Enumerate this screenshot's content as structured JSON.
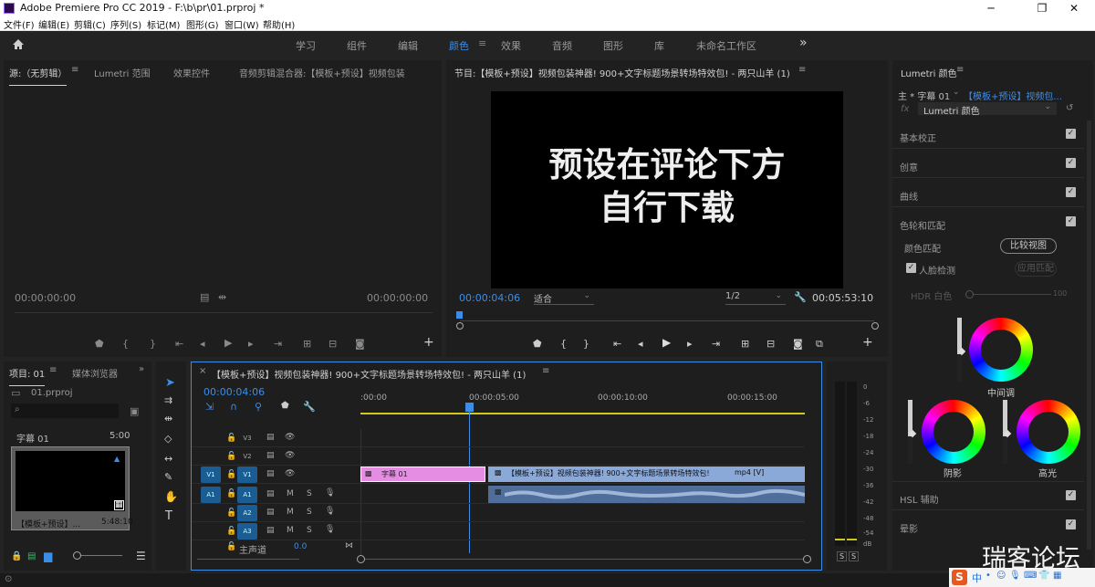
{
  "titlebar": {
    "title": "Adobe Premiere Pro CC 2019 - F:\\b\\pr\\01.prproj *",
    "min": "─",
    "max": "❐",
    "close": "✕"
  },
  "menu": [
    "文件(F)",
    "编辑(E)",
    "剪辑(C)",
    "序列(S)",
    "标记(M)",
    "图形(G)",
    "窗口(W)",
    "帮助(H)"
  ],
  "workspaces": [
    "学习",
    "组件",
    "编辑",
    "颜色",
    "效果",
    "音频",
    "图形",
    "库",
    "未命名工作区"
  ],
  "workspace_more": "»",
  "source": {
    "tabs": [
      "源:（无剪辑）",
      "Lumetri 范围",
      "效果控件",
      "音频剪辑混合器:【模板+预设】视频包装"
    ],
    "tc_left": "00:00:00:00",
    "tc_right": "00:00:00:00"
  },
  "program": {
    "title": "节目:【模板+预设】视频包装神器! 900+文字标题场景转场特效包! - 两只山羊 (1)",
    "overlay_line1": "预设在评论下方",
    "overlay_line2": "自行下载",
    "tc": "00:00:04:06",
    "fit": "适合",
    "quality": "1/2",
    "duration": "00:05:53:10"
  },
  "project": {
    "tabs": [
      "项目: 01",
      "媒体浏览器"
    ],
    "file": "01.prproj",
    "clip_name": "字幕 01",
    "clip_dur": "5:00",
    "thumb_name": "【模板+预设】...",
    "thumb_dur": "5:48:10"
  },
  "timeline": {
    "tab": "【模板+预设】视频包装神器! 900+文字标题场景转场特效包! - 两只山羊 (1)",
    "tc": "00:00:04:06",
    "ruler": [
      ":00:00",
      "00:00:05:00",
      "00:00:10:00",
      "00:00:15:00"
    ],
    "tracks": [
      {
        "label": "V3"
      },
      {
        "label": "V2"
      },
      {
        "label": "V1",
        "src": "V1"
      },
      {
        "label": "A1",
        "src": "A1"
      },
      {
        "label": "A2"
      },
      {
        "label": "A3"
      }
    ],
    "master": "主声道",
    "master_val": "0.0",
    "clip_title": "字幕 01",
    "clip_video": "【模板+预设】视频包装神器! 900+文字标题场景转场特效包!",
    "clip_video_badge": "mp4 [V]",
    "m": "M",
    "s": "S"
  },
  "meter": {
    "scale": [
      "0",
      "-6",
      "-12",
      "-18",
      "-24",
      "-30",
      "-36",
      "-42",
      "-48",
      "-54",
      "dB"
    ],
    "solo": "S"
  },
  "lumetri": {
    "title": "Lumetri 颜色",
    "master": "主 * 字幕 01",
    "seq": "【模板+预设】视频包...",
    "fx_label": "fx",
    "fx_value": "Lumetri 颜色",
    "sections": [
      "基本校正",
      "创意",
      "曲线",
      "色轮和匹配"
    ],
    "color_match": "颜色匹配",
    "compare_btn": "比较视图",
    "face_detect": "人脸检测",
    "apply_match": "应用匹配",
    "hdr": "HDR 白色",
    "hdr_val": "100",
    "wheels": [
      "中间调",
      "阴影",
      "高光"
    ],
    "hsl": "HSL 辅助",
    "vignette": "晕影"
  },
  "watermark": "瑞客论坛",
  "taskbar": {
    "brand": "S",
    "lang": "中"
  }
}
